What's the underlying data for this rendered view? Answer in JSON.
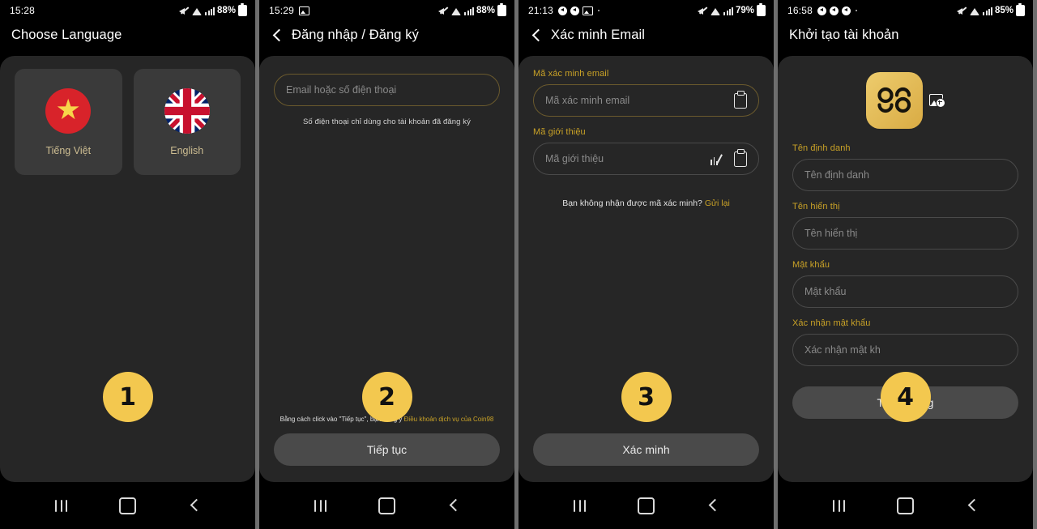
{
  "screens": [
    {
      "id": "choose-language",
      "status": {
        "time": "15:28",
        "battery_pct": "88%",
        "icons": [
          "mute-icon",
          "wifi-icon",
          "signal-icon",
          "battery-icon"
        ]
      },
      "header": {
        "title": "Choose Language",
        "has_back": false
      },
      "languages": [
        {
          "label": "Tiếng Việt",
          "flag": "vietnam-flag"
        },
        {
          "label": "English",
          "flag": "uk-flag"
        }
      ],
      "badge": "1"
    },
    {
      "id": "login-register",
      "status": {
        "time": "15:29",
        "battery_pct": "88%",
        "icons": [
          "gallery-icon",
          "mute-icon",
          "wifi-icon",
          "signal-icon",
          "battery-icon"
        ]
      },
      "header": {
        "title": "Đăng nhập / Đăng ký",
        "has_back": true
      },
      "email_field": {
        "placeholder": "Email hoặc số điện thoại",
        "value": ""
      },
      "hint": "Số điện thoại chỉ dùng cho tài khoản đã đăng ký",
      "terms_prefix": "Bằng cách click vào \"Tiếp tục\", bạn đồng ý ",
      "terms_link": "Điều khoản dịch vụ của Coin98",
      "cta": "Tiếp tục",
      "badge": "2"
    },
    {
      "id": "verify-email",
      "status": {
        "time": "21:13",
        "battery_pct": "79%",
        "icons": [
          "play-icon",
          "play-icon",
          "gallery-icon",
          "mute-icon",
          "wifi-icon",
          "signal-icon",
          "battery-icon"
        ]
      },
      "header": {
        "title": "Xác minh Email",
        "has_back": true
      },
      "fields": [
        {
          "label": "Mã xác minh email",
          "placeholder": "Mã xác minh email",
          "value": "",
          "icons": [
            "clipboard-icon"
          ]
        },
        {
          "label": "Mã giới thiệu",
          "placeholder": "Mã giới thiệu",
          "value": "",
          "icons": [
            "scanner-icon",
            "clipboard-icon"
          ]
        }
      ],
      "resend_text": "Bạn không nhận được mã xác minh? ",
      "resend_link": "Gửi lại",
      "cta": "Xác minh",
      "badge": "3"
    },
    {
      "id": "create-account",
      "status": {
        "time": "16:58",
        "battery_pct": "85%",
        "icons": [
          "play-icon",
          "play-icon",
          "play-icon",
          "mute-icon",
          "wifi-icon",
          "signal-icon",
          "battery-icon"
        ]
      },
      "header": {
        "title": "Khởi tạo tài khoản",
        "has_back": false
      },
      "avatar": {
        "logo": "coin98-logo",
        "edit": "add-photo-icon"
      },
      "fields": [
        {
          "label": "Tên định danh",
          "placeholder": "Tên định danh",
          "value": ""
        },
        {
          "label": "Tên hiển thị",
          "placeholder": "Tên hiển thị",
          "value": ""
        },
        {
          "label": "Mật khẩu",
          "placeholder": "Mật khẩu",
          "value": ""
        },
        {
          "label": "Xác nhận mật khẩu",
          "placeholder": "Xác nhận mật kh",
          "value": ""
        }
      ],
      "cta": "Tận hưởng",
      "badge": "4"
    }
  ],
  "navbar": {
    "recents": "recents-icon",
    "home": "home-icon",
    "back": "back-icon"
  },
  "colors": {
    "accent": "#c9a227",
    "badge": "#f3c84f",
    "card_bg": "#262626",
    "page_bg": "#6e6e6e"
  }
}
